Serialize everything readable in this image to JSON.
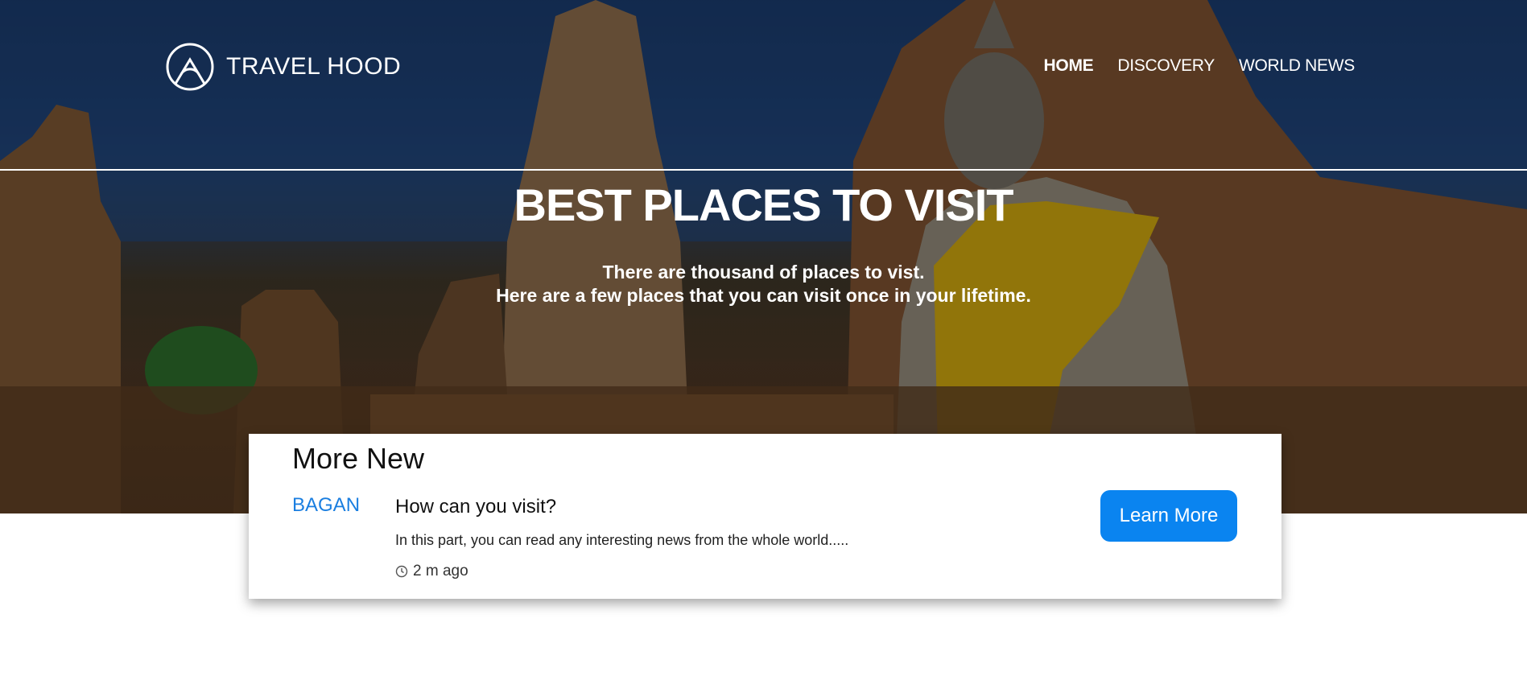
{
  "brand": {
    "name": "TRAVEL HOOD",
    "logo_icon": "mountain-circle-icon"
  },
  "nav": {
    "items": [
      {
        "label": "HOME",
        "active": true
      },
      {
        "label": "DISCOVERY",
        "active": false
      },
      {
        "label": "WORLD NEWS",
        "active": false
      }
    ]
  },
  "hero": {
    "title": "BEST PLACES TO VISIT",
    "subtitle_line1": "There are thousand of places to vist.",
    "subtitle_line2": "Here are a few places that you can visit once in your lifetime."
  },
  "card": {
    "heading": "More New",
    "tag": "BAGAN",
    "title": "How can you visit?",
    "description": "In this part, you can read any interesting news from the whole world.....",
    "time": "2 m ago",
    "time_icon": "clock-icon",
    "button_label": "Learn More"
  },
  "colors": {
    "accent": "#0a84f0",
    "tag": "#1a7ee0",
    "hero_text": "#ffffff"
  }
}
